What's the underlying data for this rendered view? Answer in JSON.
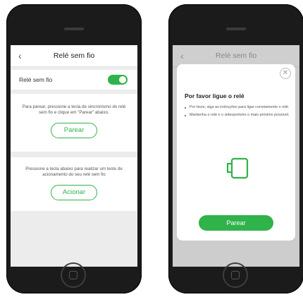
{
  "left_screen": {
    "header": {
      "back_icon": "chevron-left-icon",
      "title": "Relé sem fio"
    },
    "toggle_row": {
      "label": "Relé sem fio",
      "enabled": true
    },
    "pair_card": {
      "text": "Para parear, pressione a tecla de sincronismo do relé sem fio e clique em \"Parear\" abaixo.",
      "button_label": "Parear"
    },
    "test_card": {
      "text": "Pressione a tecla abaixo para realizar um teste de acionamento do seu relé sem fio",
      "button_label": "Acionar"
    }
  },
  "right_screen": {
    "header": {
      "back_icon": "chevron-left-icon",
      "title": "Relé sem fio"
    },
    "modal": {
      "close_icon": "close-icon",
      "title": "Por favor ligue o relé",
      "bullets": [
        "Por favor, siga as instruções para ligar corretamente o relé.",
        "Mantenha o relé e o videoporteiro o mais próximo possível."
      ],
      "illustration_icon": "relay-device-icon",
      "button_label": "Parear"
    }
  },
  "colors": {
    "accent": "#2fb34a",
    "background": "#ececec",
    "phone_body": "#1b1b1b"
  }
}
